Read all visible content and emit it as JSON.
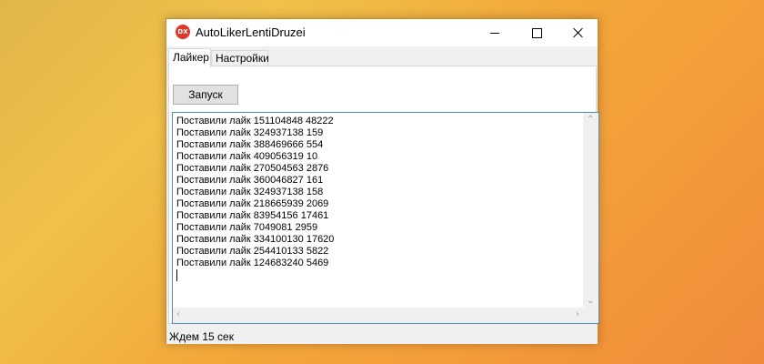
{
  "colors": {
    "accent": "#4f8fc0",
    "app_icon": "#e0362b"
  },
  "window": {
    "title": "AutoLikerLentiDruzei",
    "icon_text": "DX",
    "icon_name": "app-logo-icon"
  },
  "tabs": [
    {
      "label": "Лайкер",
      "selected": true
    },
    {
      "label": "Настройки",
      "selected": false
    }
  ],
  "liker": {
    "start_label": "Запуск",
    "log": [
      "Поставили лайк 151104848 48222",
      "Поставили лайк 324937138 159",
      "Поставили лайк 388469666 554",
      "Поставили лайк 409056319 10",
      "Поставили лайк 270504563 2876",
      "Поставили лайк 360046827 161",
      "Поставили лайк 324937138 158",
      "Поставили лайк 218665939 2069",
      "Поставили лайк 83954156 17461",
      "Поставили лайк 7049081 2959",
      "Поставили лайк 334100130 17620",
      "Поставили лайк 254410133 5822",
      "Поставили лайк 124683240 5469"
    ]
  },
  "status_text": "Ждем 15 сек"
}
